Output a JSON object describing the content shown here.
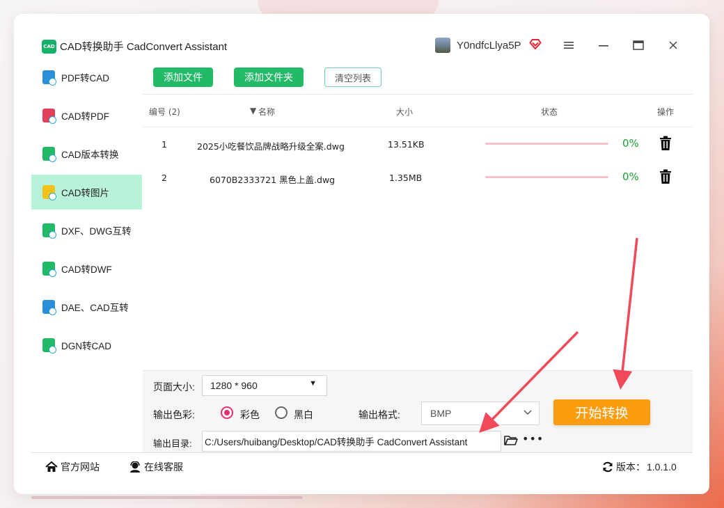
{
  "app": {
    "title": "CAD转换助手 CadConvert Assistant",
    "logo_text": "CAD",
    "username": "Y0ndfcLlya5P",
    "vip_icon": "heart-diamond-icon",
    "window_controls": [
      "menu-icon",
      "minimize-icon",
      "maximize-icon",
      "close-icon"
    ]
  },
  "sidebar": {
    "active_index": 3,
    "items": [
      {
        "label": "PDF转CAD",
        "color": "#2a8fd8"
      },
      {
        "label": "CAD转PDF",
        "color": "#e0405a"
      },
      {
        "label": "CAD版本转换",
        "color": "#22b967"
      },
      {
        "label": "CAD转图片",
        "color": "#f3c21a"
      },
      {
        "label": "DXF、DWG互转",
        "color": "#22b967"
      },
      {
        "label": "CAD转DWF",
        "color": "#22b967"
      },
      {
        "label": "DAE、CAD互转",
        "color": "#2a8fd8"
      },
      {
        "label": "DGN转CAD",
        "color": "#22b967"
      }
    ]
  },
  "toolbar": {
    "add_file": "添加文件",
    "add_folder": "添加文件夹",
    "clear_list": "清空列表"
  },
  "table": {
    "headers": {
      "index": "编号 (2)",
      "name": "名称",
      "size": "大小",
      "status": "状态",
      "action": "操作"
    },
    "rows": [
      {
        "index": "1",
        "name": "2025小吃餐饮品牌战略升级全案.dwg",
        "size": "13.51KB",
        "progress": "0%"
      },
      {
        "index": "2",
        "name": "6070B2333721 黑色上盖.dwg",
        "size": "1.35MB",
        "progress": "0%"
      }
    ]
  },
  "settings": {
    "page_size_label": "页面大小:",
    "page_size_value": "1280 * 960",
    "color_label": "输出色彩:",
    "color_option_color": "彩色",
    "color_option_bw": "黑白",
    "color_selected": "彩色",
    "format_label": "输出格式:",
    "format_value": "BMP",
    "output_dir_label": "输出目录:",
    "output_dir_value": "C:/Users/huibang/Desktop/CAD转换助手 CadConvert Assistant",
    "start_button": "开始转换",
    "accent_color": "#fc9c0f",
    "radio_color": "#e6306a"
  },
  "footer": {
    "website": "官方网站",
    "support": "在线客服",
    "version_label": "版本：",
    "version_value": "1.0.1.0"
  }
}
